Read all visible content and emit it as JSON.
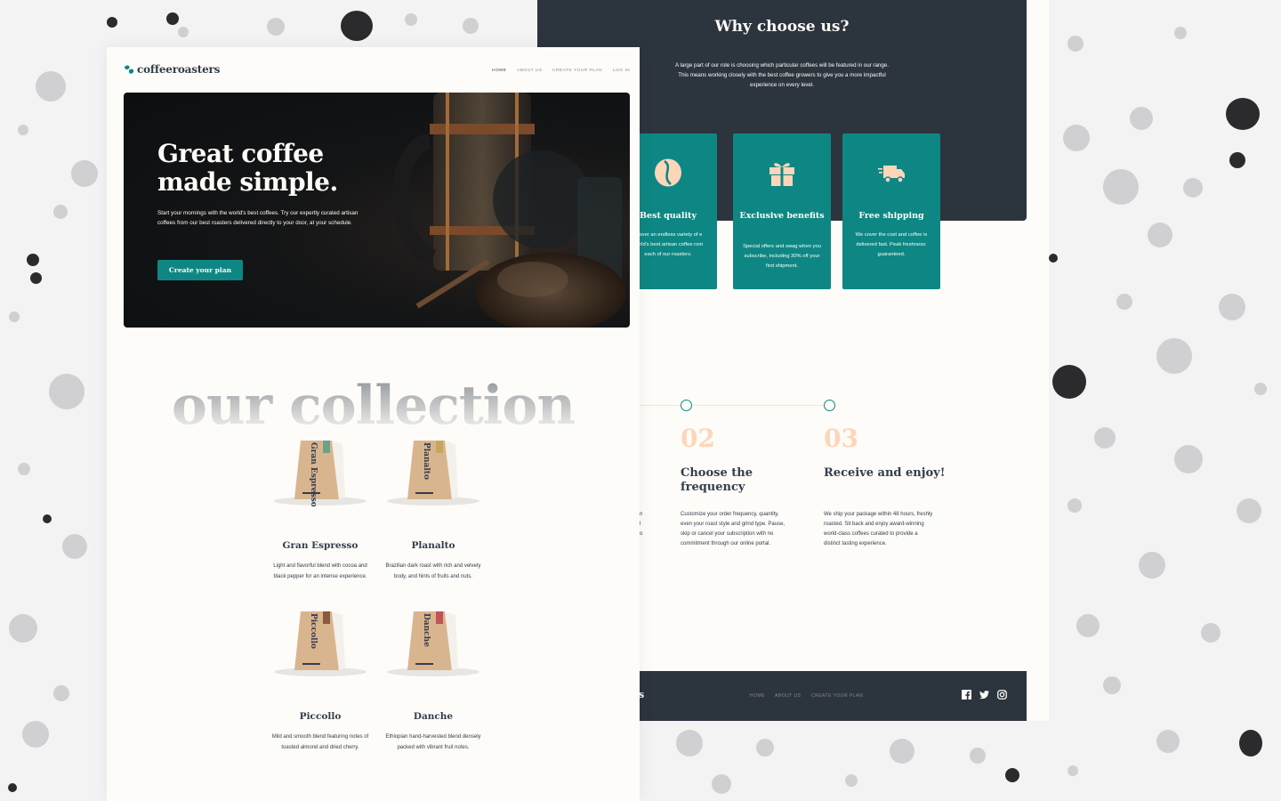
{
  "brand": {
    "name": "coffeeroasters",
    "footer_name_fragment": "s"
  },
  "nav": {
    "home": "HOME",
    "about": "ABOUT US",
    "plan": "CREATE YOUR PLAN",
    "login": "LOG IN"
  },
  "hero": {
    "title_line1": "Great coffee",
    "title_line2": "made simple.",
    "text": "Start your mornings with the world's best coffees. Try our expertly curated artisan coffees from our best roasters delivered directly to your door, at your schedule.",
    "button": "Create your plan"
  },
  "collection": {
    "title": "our collection",
    "products": [
      {
        "name": "Gran Espresso",
        "bag_label": "Gran Espresso",
        "desc": "Light and flavorful blend with cocoa and black pepper for an intense experience.",
        "tag_color": "#6fa086"
      },
      {
        "name": "Planalto",
        "bag_label": "Planalto",
        "desc": "Brazilian dark roast with rich and velvety body, and hints of fruits and nuts.",
        "tag_color": "#c6a75b"
      },
      {
        "name": "Piccollo",
        "bag_label": "Piccollo",
        "desc": "Mild and smooth blend featuring notes of toasted almond and dried cherry.",
        "tag_color": "#8b5a3c"
      },
      {
        "name": "Danche",
        "bag_label": "Danche",
        "desc": "Ethiopian hand-harvested blend densely packed with vibrant fruit notes.",
        "tag_color": "#c0525c"
      }
    ]
  },
  "why": {
    "title": "Why choose us?",
    "text": "A large part of our role is choosing which particular coffees will be featured in our range. This means working closely with the best coffee growers to give you a more impactful experience on every level.",
    "cards": [
      {
        "title": "Best quality",
        "text": "scover an endless variety of e world's best artisan coffee rom each of our roasters.",
        "icon": "coffee-bean-icon"
      },
      {
        "title": "Exclusive benefits",
        "text": "Special offers and swag when you subscribe, including 30% off your first shipment.",
        "icon": "gift-icon"
      },
      {
        "title": "Free shipping",
        "text": "We cover the cost and coffee is delivered fast. Peak freshness: guaranteed.",
        "icon": "truck-icon"
      }
    ]
  },
  "steps": [
    {
      "num": "02",
      "title": "Choose the frequency",
      "text": "Customize your order frequency, quantity, even your roast style and grind type. Pause, skip or cancel your subscription with no commitment through our online portal."
    },
    {
      "num": "03",
      "title": "Receive and enjoy!",
      "text": "We ship your package within 48 hours, freshly roasted. Sit back and enjoy award-winning world-class coffees curated to provide a distinct tasting experience."
    }
  ],
  "step1_fragments": [
    "n",
    "l",
    "o"
  ],
  "footer": {
    "home": "HOME",
    "about": "ABOUT US",
    "plan": "CREATE YOUR PLAN"
  },
  "colors": {
    "accent": "#0e8784",
    "dark": "#333d4b",
    "band": "#2c343e",
    "peach": "#fdd6ba",
    "page": "#fdfcf8"
  }
}
